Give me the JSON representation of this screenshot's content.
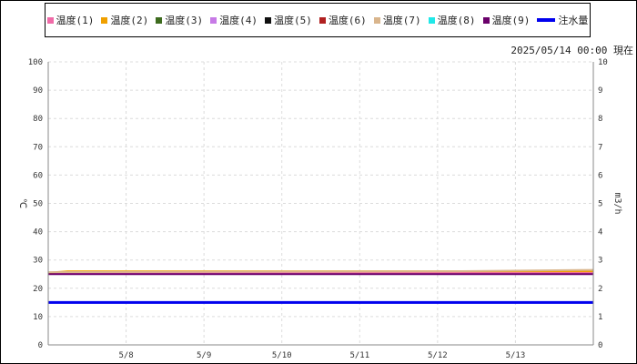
{
  "legend": [
    {
      "label": "温度(1)",
      "color": "#f06ba8",
      "kind": "square"
    },
    {
      "label": "温度(2)",
      "color": "#f0a000",
      "kind": "square"
    },
    {
      "label": "温度(3)",
      "color": "#3d6b1e",
      "kind": "square"
    },
    {
      "label": "温度(4)",
      "color": "#c77ae6",
      "kind": "square"
    },
    {
      "label": "温度(5)",
      "color": "#101010",
      "kind": "square"
    },
    {
      "label": "温度(6)",
      "color": "#b02020",
      "kind": "square"
    },
    {
      "label": "温度(7)",
      "color": "#d9b58c",
      "kind": "square"
    },
    {
      "label": "温度(8)",
      "color": "#20e8e8",
      "kind": "square"
    },
    {
      "label": "温度(9)",
      "color": "#6a006a",
      "kind": "square"
    },
    {
      "label": "注水量",
      "color": "#0000ee",
      "kind": "line"
    }
  ],
  "timestamp": "2025/05/14 00:00 現在",
  "chart_data": {
    "type": "line",
    "ylabel_left": "℃",
    "ylabel_right": "m3/h",
    "ylim_left": [
      0,
      100
    ],
    "ylim_right": [
      0,
      10
    ],
    "yticks_left": [
      0,
      10,
      20,
      30,
      40,
      50,
      60,
      70,
      80,
      90,
      100
    ],
    "yticks_right": [
      0,
      1,
      2,
      3,
      4,
      5,
      6,
      7,
      8,
      9,
      10
    ],
    "xlim": [
      "5/7",
      "5/14"
    ],
    "xticks": [
      "5/8",
      "5/9",
      "5/10",
      "5/11",
      "5/12",
      "5/13"
    ],
    "grid": true,
    "series": [
      {
        "name": "温度(1)",
        "axis": "left",
        "x": [
          "5/7",
          "5/14"
        ],
        "values": [
          25.5,
          25.5
        ]
      },
      {
        "name": "温度(2)",
        "axis": "left",
        "x": [
          "5/7",
          "5/7 06:00",
          "5/14"
        ],
        "values": [
          25.5,
          26.0,
          26.0
        ]
      },
      {
        "name": "温度(7)",
        "axis": "left",
        "x": [
          "5/7",
          "5/12 06:00",
          "5/14"
        ],
        "values": [
          25.7,
          26.0,
          26.5
        ]
      },
      {
        "name": "温度(9)",
        "axis": "left",
        "x": [
          "5/7",
          "5/14"
        ],
        "values": [
          25.0,
          25.0
        ]
      },
      {
        "name": "注水量",
        "axis": "right",
        "x": [
          "5/7",
          "5/14"
        ],
        "values": [
          1.5,
          1.5
        ]
      }
    ]
  }
}
